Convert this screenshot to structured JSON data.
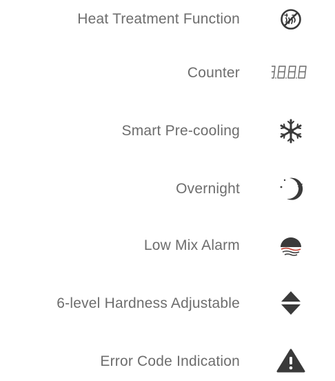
{
  "features": [
    {
      "label": "Heat  Treatment  Function",
      "icon": "heat-treatment-off-icon"
    },
    {
      "label": "Counter",
      "icon": "digital-counter-icon"
    },
    {
      "label": "Smart Pre-cooling",
      "icon": "snowflake-icon"
    },
    {
      "label": "Overnight",
      "icon": "moon-stars-icon"
    },
    {
      "label": "Low Mix Alarm",
      "icon": "low-mix-bowl-icon"
    },
    {
      "label": "6-level Hardness Adjustable",
      "icon": "up-down-arrows-icon"
    },
    {
      "label": "Error Code Indication",
      "icon": "warning-triangle-icon"
    }
  ],
  "colors": {
    "text": "#6d6d6d",
    "icon": "#3a3a3a"
  }
}
